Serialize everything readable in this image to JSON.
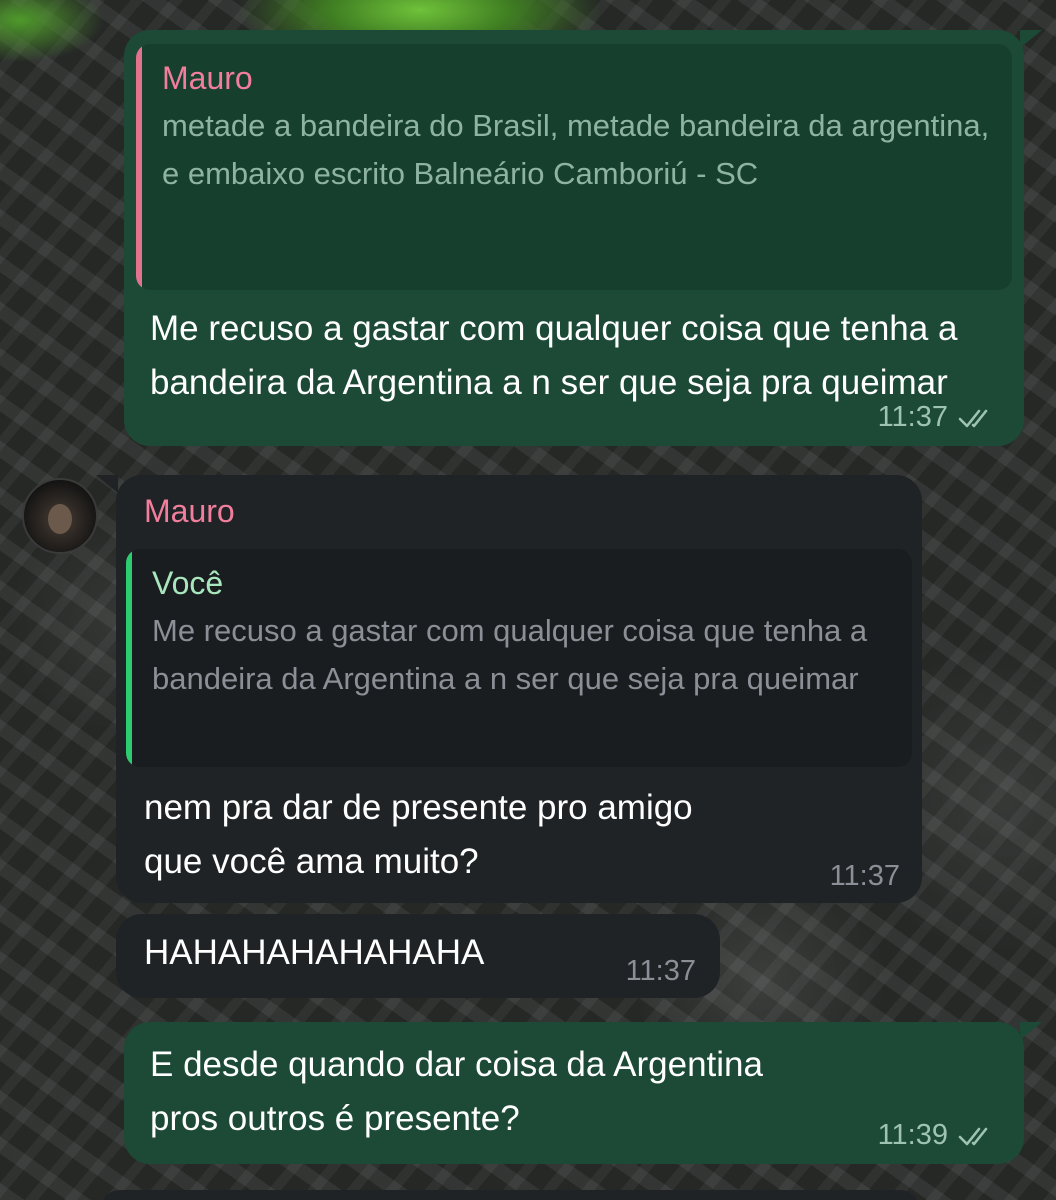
{
  "messages": [
    {
      "direction": "outgoing",
      "reply": {
        "author": "Mauro",
        "text": "metade a bandeira do Brasil, metade bandeira da argentina, e embaixo escrito Balneário Camboriú - SC"
      },
      "text": "Me recuso a gastar com qualquer coisa que tenha a bandeira da Argentina a n ser que seja pra queimar",
      "time": "11:37",
      "status": "read"
    },
    {
      "direction": "incoming",
      "sender": "Mauro",
      "reply": {
        "author": "Você",
        "text": "Me recuso a gastar com qualquer coisa que tenha a bandeira da Argentina a n ser que seja pra queimar"
      },
      "text": "nem pra dar de presente pro amigo\nque você ama muito?",
      "time": "11:37"
    },
    {
      "direction": "incoming",
      "text": "HAHAHAHAHAHAHA",
      "time": "11:37"
    },
    {
      "direction": "outgoing",
      "text": "E desde quando dar coisa da Argentina\npros outros é presente?",
      "time": "11:39",
      "status": "read"
    }
  ],
  "colors": {
    "outgoing_bubble": "#1c4a36",
    "incoming_bubble": "#1f2326",
    "reply_bar_pink": "#e3728f",
    "reply_bar_green": "#2ecc71",
    "sender_name": "#f07e9c"
  },
  "icons": {
    "read_status": "double-check-icon",
    "avatar": "contact-avatar"
  }
}
